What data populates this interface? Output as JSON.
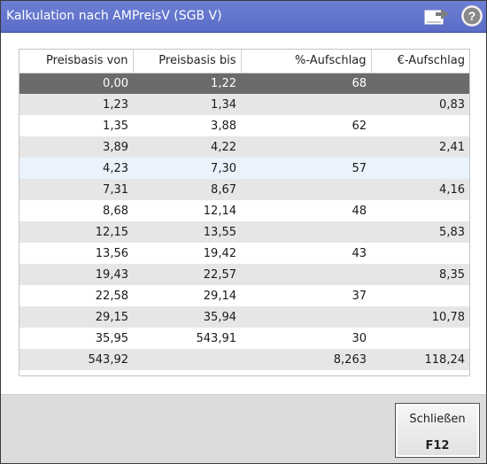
{
  "window": {
    "title": "Kalkulation nach AMPreisV (SGB V)",
    "export_icon": "export-icon",
    "help_icon": "help-icon"
  },
  "table": {
    "columns": [
      "Preisbasis von",
      "Preisbasis bis",
      "%-Aufschlag",
      "€-Aufschlag"
    ],
    "rows": [
      [
        "0,00",
        "1,22",
        "68",
        ""
      ],
      [
        "1,23",
        "1,34",
        "",
        "0,83"
      ],
      [
        "1,35",
        "3,88",
        "62",
        ""
      ],
      [
        "3,89",
        "4,22",
        "",
        "2,41"
      ],
      [
        "4,23",
        "7,30",
        "57",
        ""
      ],
      [
        "7,31",
        "8,67",
        "",
        "4,16"
      ],
      [
        "8,68",
        "12,14",
        "48",
        ""
      ],
      [
        "12,15",
        "13,55",
        "",
        "5,83"
      ],
      [
        "13,56",
        "19,42",
        "43",
        ""
      ],
      [
        "19,43",
        "22,57",
        "",
        "8,35"
      ],
      [
        "22,58",
        "29,14",
        "37",
        ""
      ],
      [
        "29,15",
        "35,94",
        "",
        "10,78"
      ],
      [
        "35,95",
        "543,91",
        "30",
        ""
      ],
      [
        "543,92",
        "",
        "8,263",
        "118,24"
      ]
    ],
    "selected_row": 0
  },
  "footer": {
    "close_button": {
      "label": "Schließen",
      "key": "F12"
    }
  },
  "colors": {
    "titlebar": "#5a6cc6",
    "selected_row": "#6b6b6b",
    "alt_row": "#e6e6e6"
  }
}
